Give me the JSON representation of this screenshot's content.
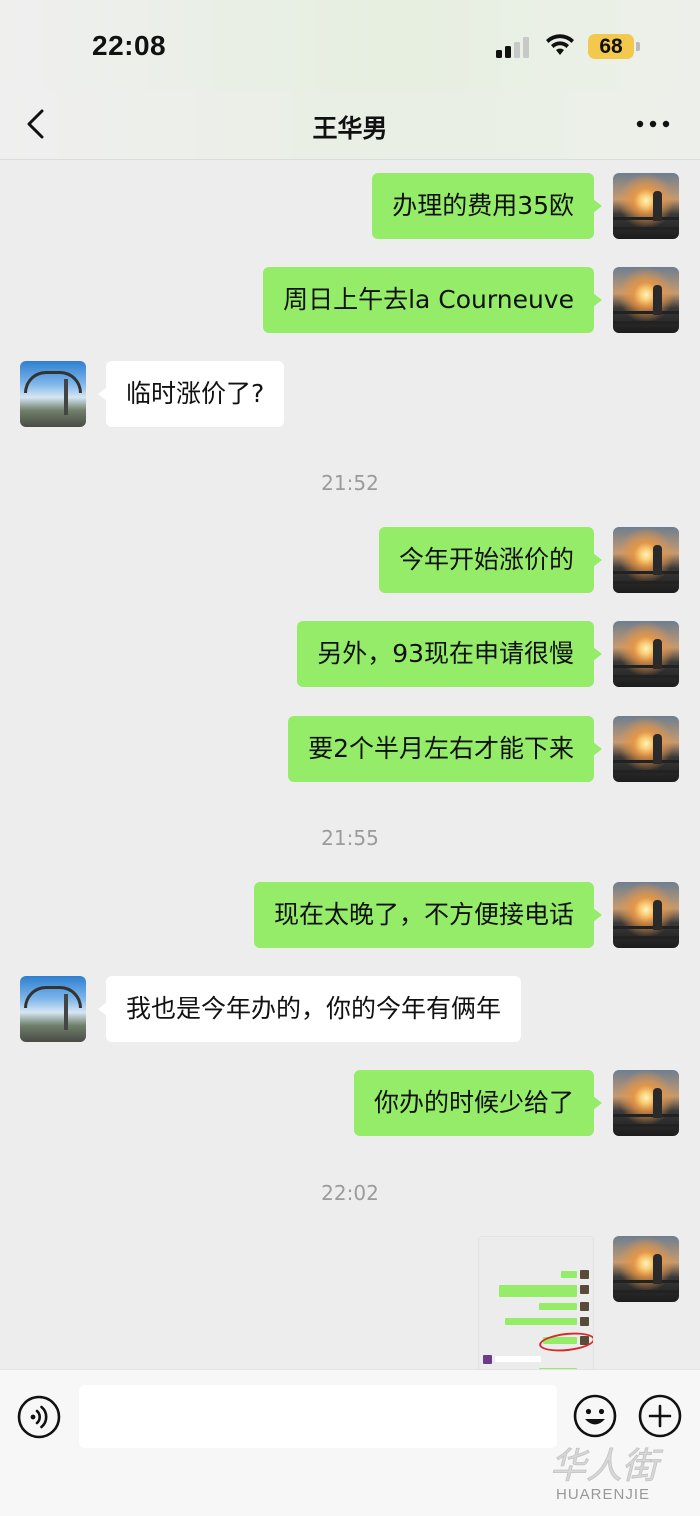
{
  "status_bar": {
    "time": "22:08",
    "battery": "68",
    "icons": [
      "signal-icon",
      "wifi-icon",
      "battery-icon"
    ]
  },
  "nav": {
    "title": "王华男",
    "back_icon": "chevron-left-icon",
    "more_icon": "more-dots-icon"
  },
  "messages": [
    {
      "side": "right",
      "text": "办理的费用35欧"
    },
    {
      "side": "right",
      "text": "周日上午去la Courneuve"
    },
    {
      "side": "left",
      "text": "临时涨价了?"
    },
    {
      "type": "time",
      "text": "21:52"
    },
    {
      "side": "right",
      "text": "今年开始涨价的"
    },
    {
      "side": "right",
      "text": "另外，93现在申请很慢"
    },
    {
      "side": "right",
      "text": "要2个半月左右才能下来"
    },
    {
      "type": "time",
      "text": "21:55"
    },
    {
      "side": "right",
      "text": "现在太晚了，不方便接电话"
    },
    {
      "side": "left",
      "text": "我也是今年办的，你的今年有俩年"
    },
    {
      "side": "right",
      "text": "你办的时候少给了"
    },
    {
      "type": "time",
      "text": "22:02"
    },
    {
      "side": "right",
      "type": "image",
      "image_label": "screenshot-thumbnail"
    }
  ],
  "input_bar": {
    "voice_icon": "voice-icon",
    "emoji_icon": "emoji-icon",
    "plus_icon": "plus-icon",
    "text_value": ""
  },
  "watermark": {
    "logo_text": "华人街",
    "sub_text": "HUARENJIE"
  },
  "colors": {
    "outgoing_bubble": "#95ec69",
    "incoming_bubble": "#ffffff",
    "background": "#ededed",
    "battery": "#f2c94c"
  }
}
